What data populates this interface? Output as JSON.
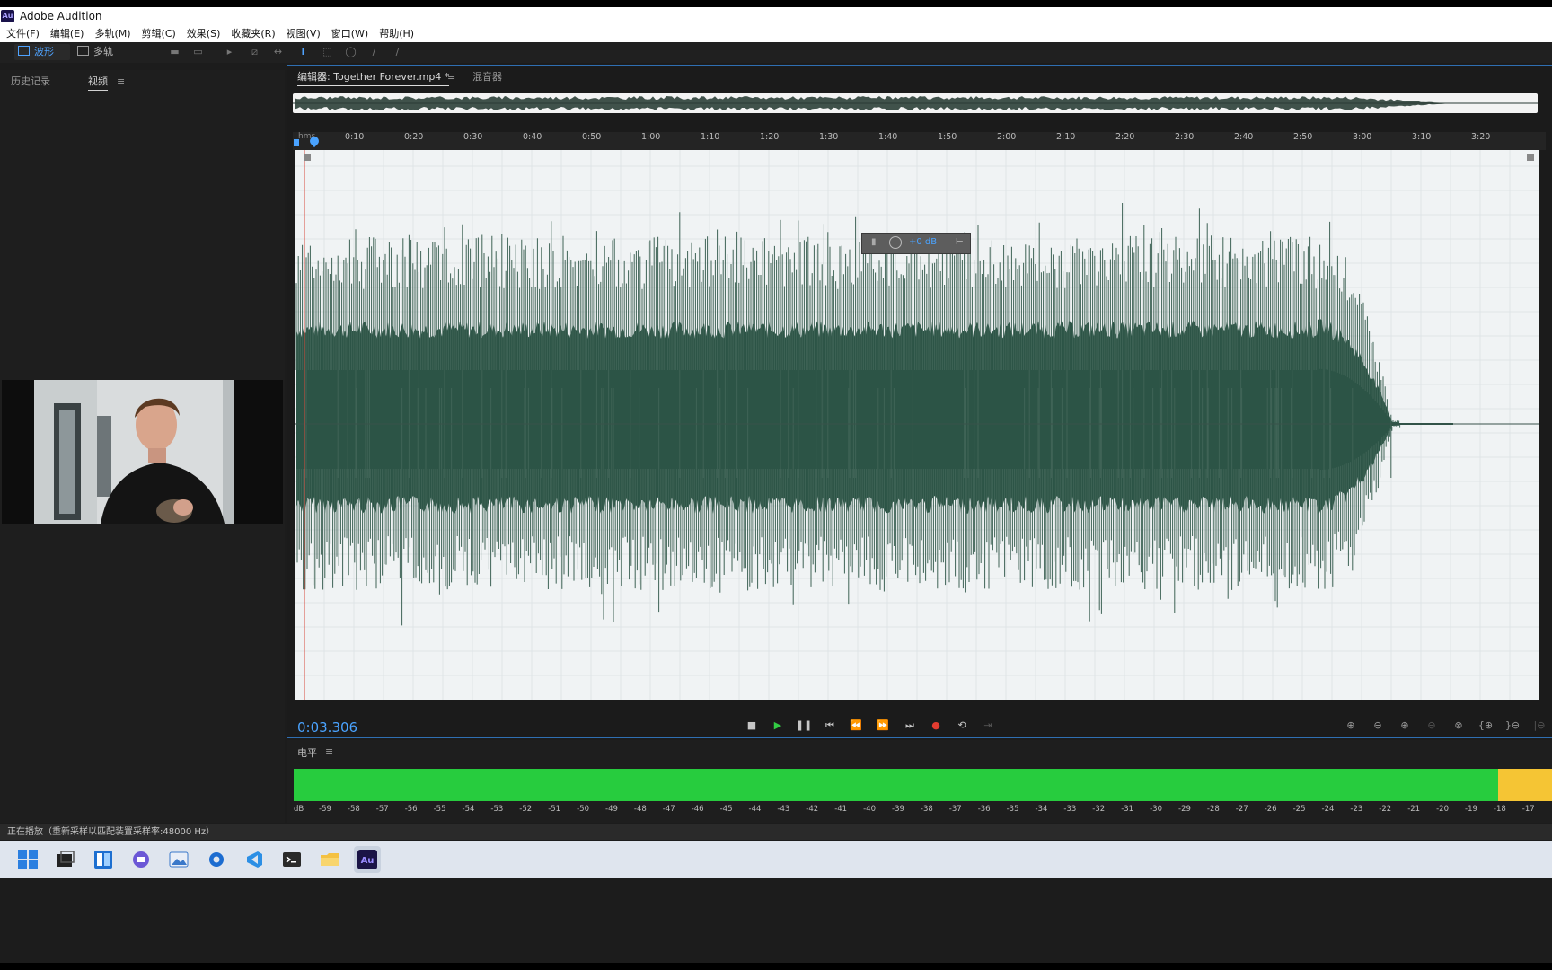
{
  "window": {
    "title": "Adobe Audition",
    "logo_text": "Au"
  },
  "menu": [
    "文件(F)",
    "编辑(E)",
    "多轨(M)",
    "剪辑(C)",
    "效果(S)",
    "收藏夹(R)",
    "视图(V)",
    "窗口(W)",
    "帮助(H)"
  ],
  "toolbar": {
    "waveform_label": "波形",
    "multitrack_label": "多轨"
  },
  "left_panel": {
    "history_tab": "历史记录",
    "video_tab": "视频",
    "menu_icon": "≡"
  },
  "editor": {
    "tab_label": "编辑器: Together Forever.mp4 *",
    "mixer_tab": "混音器",
    "ruler_start": "hms",
    "ruler_ticks": [
      "0:10",
      "0:20",
      "0:30",
      "0:40",
      "0:50",
      "1:00",
      "1:10",
      "1:20",
      "1:30",
      "1:40",
      "1:50",
      "2:00",
      "2:10",
      "2:20",
      "2:30",
      "2:40",
      "2:50",
      "3:00",
      "3:10",
      "3:20"
    ],
    "hud_gain": "+0 dB",
    "current_time": "0:03.306"
  },
  "levels": {
    "title": "电平",
    "db_label": "dB",
    "ticks": [
      "-59",
      "-58",
      "-57",
      "-56",
      "-55",
      "-54",
      "-53",
      "-52",
      "-51",
      "-50",
      "-49",
      "-48",
      "-47",
      "-46",
      "-45",
      "-44",
      "-43",
      "-42",
      "-41",
      "-40",
      "-39",
      "-38",
      "-37",
      "-36",
      "-35",
      "-34",
      "-33",
      "-32",
      "-31",
      "-30",
      "-29",
      "-28",
      "-27",
      "-26",
      "-25",
      "-24",
      "-23",
      "-22",
      "-21",
      "-20",
      "-19",
      "-18",
      "-17"
    ],
    "green_fill": 0.957,
    "colors": {
      "green": "#27cc3e",
      "yellow": "#f5c534"
    }
  },
  "status": {
    "text": "正在播放（重新采样以匹配装置采样率:48000 Hz）"
  },
  "colors": {
    "accent": "#2f6fb2",
    "waveform": "#2c5446",
    "playhead": "#d84b3e",
    "time": "#4aa3ff"
  }
}
